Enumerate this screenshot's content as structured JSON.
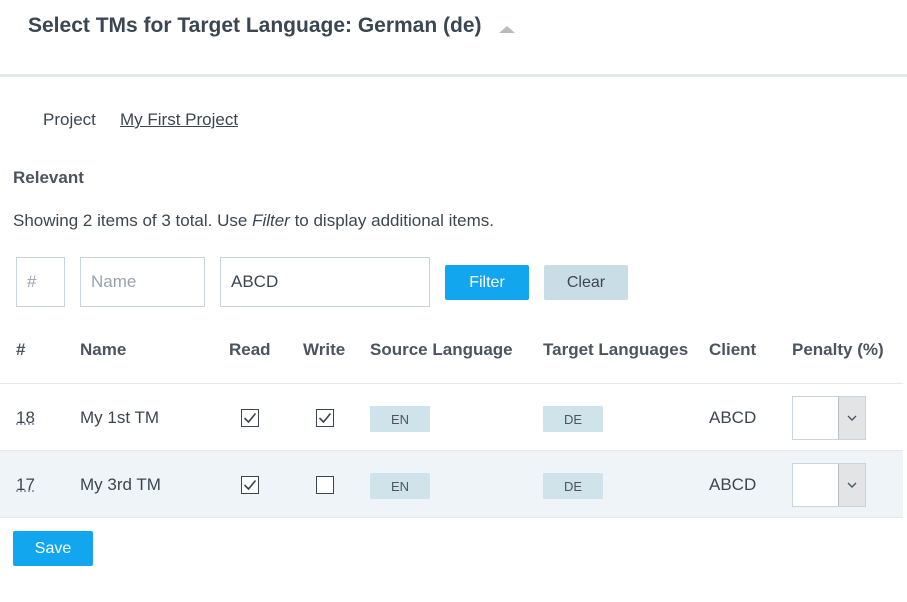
{
  "header": {
    "title": "Select TMs for Target Language: German (de)"
  },
  "project": {
    "label": "Project",
    "name": "My First Project"
  },
  "section": {
    "title": "Relevant",
    "showing_prefix": "Showing 2 items of 3 total. Use ",
    "showing_filter": "Filter",
    "showing_suffix": " to display additional items."
  },
  "filters": {
    "number_placeholder": "#",
    "name_placeholder": "Name",
    "client_value": "ABCD",
    "filter_label": "Filter",
    "clear_label": "Clear"
  },
  "table": {
    "columns": [
      "#",
      "Name",
      "Read",
      "Write",
      "Source Language",
      "Target Languages",
      "Client",
      "Penalty (%)"
    ],
    "rows": [
      {
        "id": "18",
        "name": "My 1st TM",
        "read": true,
        "write": true,
        "source": "EN",
        "target": "DE",
        "client": "ABCD",
        "penalty": ""
      },
      {
        "id": "17",
        "name": "My 3rd TM",
        "read": true,
        "write": false,
        "source": "EN",
        "target": "DE",
        "client": "ABCD",
        "penalty": ""
      }
    ]
  },
  "footer": {
    "save_label": "Save"
  },
  "colors": {
    "primary": "#12a6ef",
    "secondary": "#c9dde6",
    "badge": "#cfe3ea",
    "row_alt": "#eef4f8"
  },
  "icons": {
    "collapse": "caret-up-icon",
    "checkbox": "checkmark-icon",
    "dropdown": "chevron-down-icon"
  }
}
